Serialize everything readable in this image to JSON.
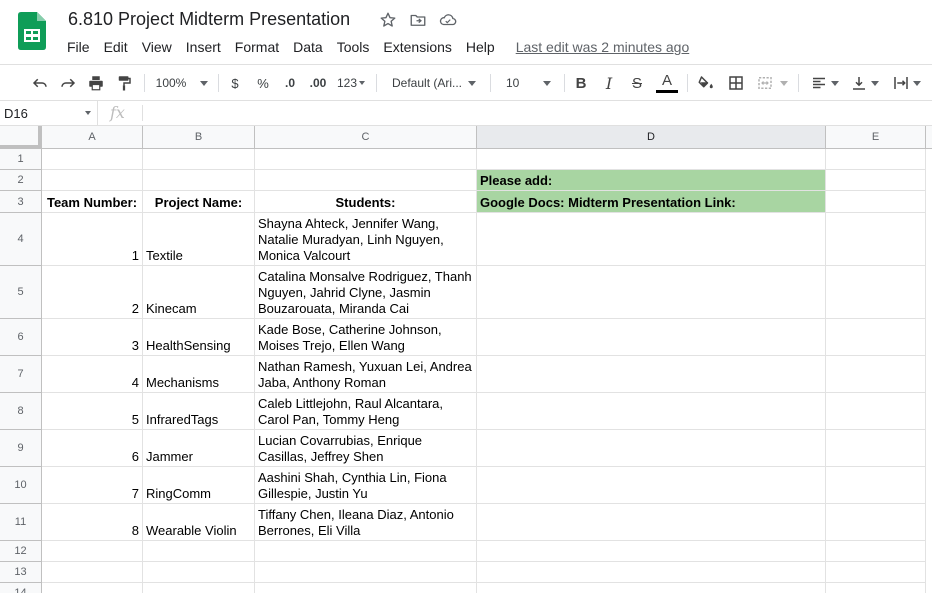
{
  "doc": {
    "title": "6.810 Project Midterm Presentation",
    "last_edit": "Last edit was 2 minutes ago"
  },
  "menu": [
    "File",
    "Edit",
    "View",
    "Insert",
    "Format",
    "Data",
    "Tools",
    "Extensions",
    "Help"
  ],
  "toolbar": {
    "zoom": "100%",
    "currency": "$",
    "percent": "%",
    "decrease_decimal": ".0",
    "increase_decimal": ".00",
    "more_formats": "123",
    "font": "Default (Ari...",
    "font_size": "10",
    "bold": "B",
    "italic": "I",
    "strike": "S",
    "text_color": "A"
  },
  "formula_bar": {
    "cell_ref": "D16",
    "fx": "fx"
  },
  "columns": [
    "A",
    "B",
    "C",
    "D",
    "E"
  ],
  "rows": [
    "1",
    "2",
    "3",
    "4",
    "5",
    "6",
    "7",
    "8",
    "9",
    "10",
    "11",
    "12",
    "13",
    "14"
  ],
  "sheet": {
    "d2": "Please add:",
    "a3": "Team Number:",
    "b3": "Project Name:",
    "c3": "Students:",
    "d3": "Google Docs: Midterm Presentation Link:",
    "teams": [
      {
        "num": "1",
        "name": "Textile",
        "students": "Shayna Ahteck, Jennifer Wang, Natalie Muradyan, Linh Nguyen, Monica Valcourt"
      },
      {
        "num": "2",
        "name": "Kinecam",
        "students": "Catalina Monsalve Rodriguez, Thanh Nguyen, Jahrid Clyne, Jasmin  Bouzarouata, Miranda Cai"
      },
      {
        "num": "3",
        "name": "HealthSensing",
        "students": "Kade Bose, Catherine Johnson, Moises Trejo, Ellen Wang"
      },
      {
        "num": "4",
        "name": "Mechanisms",
        "students": "Nathan Ramesh, Yuxuan Lei, Andrea Jaba, Anthony Roman"
      },
      {
        "num": "5",
        "name": "InfraredTags",
        "students": "Caleb Littlejohn, Raul Alcantara, Carol Pan, Tommy Heng"
      },
      {
        "num": "6",
        "name": "Jammer",
        "students": "Lucian Covarrubias, Enrique Casillas, Jeffrey Shen"
      },
      {
        "num": "7",
        "name": "RingComm",
        "students": "Aashini Shah, Cynthia Lin, Fiona Gillespie, Justin Yu"
      },
      {
        "num": "8",
        "name": "Wearable Violin",
        "students": "Tiffany Chen, Ileana Diaz, Antonio Berrones, Eli Villa"
      }
    ]
  },
  "colors": {
    "highlight_green": "#a8d5a2",
    "sheets_green": "#0f9d58"
  }
}
